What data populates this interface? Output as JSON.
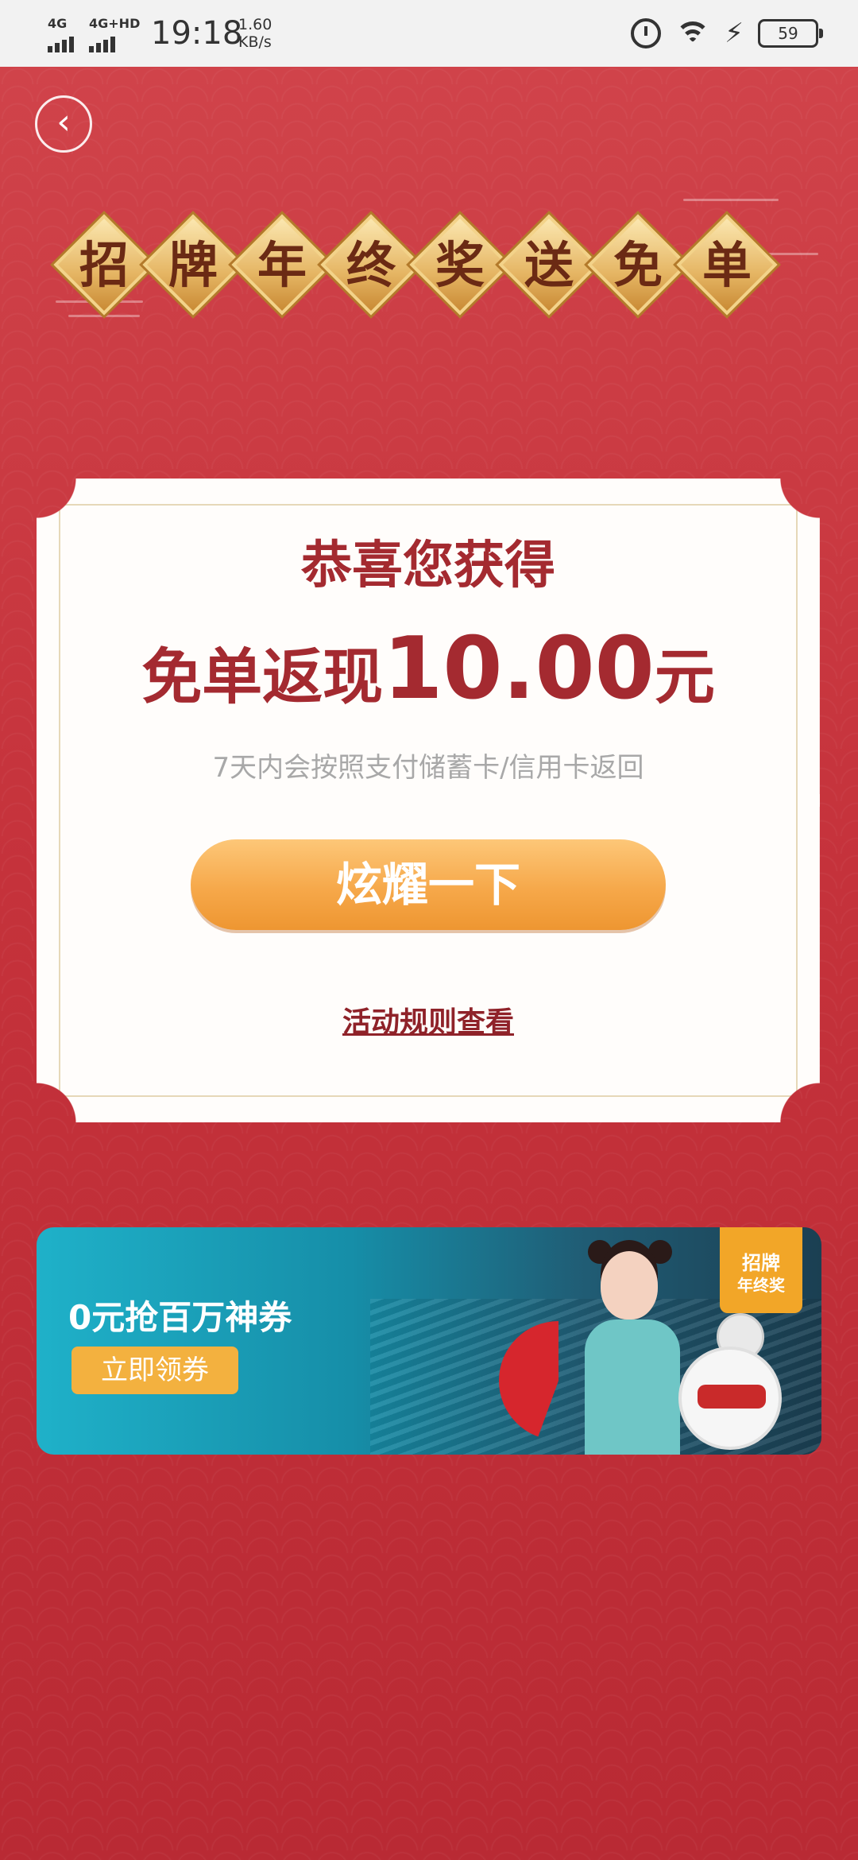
{
  "status_bar": {
    "network_1": "4G",
    "network_2": "4G+HD",
    "time": "19:18",
    "speed_value": "1.60",
    "speed_unit": "KB/s",
    "battery": "59"
  },
  "header": {
    "back_icon": "chevron-left-icon",
    "title_chars": [
      "招",
      "牌",
      "年",
      "终",
      "奖",
      "送",
      "免",
      "单"
    ]
  },
  "card": {
    "congrats": "恭喜您获得",
    "prize_prefix": "免单返现",
    "prize_amount": "10.00",
    "prize_unit": "元",
    "note": "7天内会按照支付储蓄卡/信用卡返回",
    "show_button": "炫耀一下",
    "rules_link": "活动规则查看"
  },
  "banner": {
    "title": "0元抢百万神券",
    "button": "立即领券",
    "badge_line1": "招牌",
    "badge_line2": "年终奖"
  },
  "colors": {
    "background": "#c8323b",
    "title_text": "#a42a30",
    "button": "#f6a84a",
    "banner": "#168ea8"
  }
}
